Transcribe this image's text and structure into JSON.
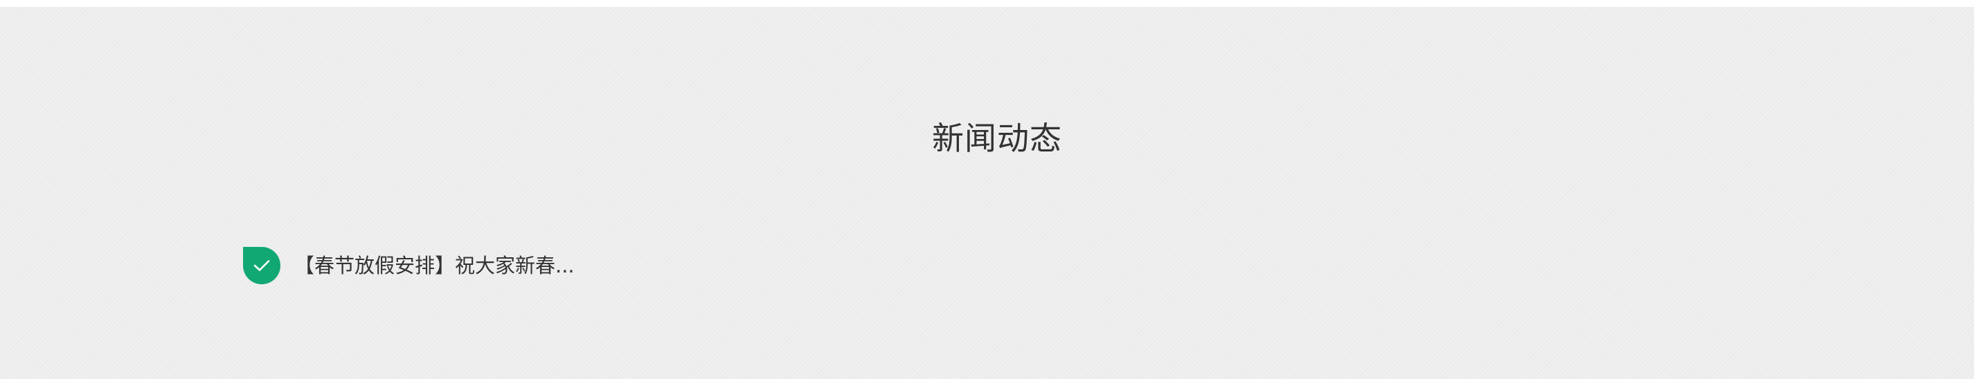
{
  "news": {
    "title": "新闻动态",
    "items": [
      {
        "icon": "check-badge-icon",
        "text": "【春节放假安排】祝大家新春..."
      }
    ]
  },
  "colors": {
    "badge": "#12a873",
    "text": "#333333",
    "background": "#ededed"
  }
}
